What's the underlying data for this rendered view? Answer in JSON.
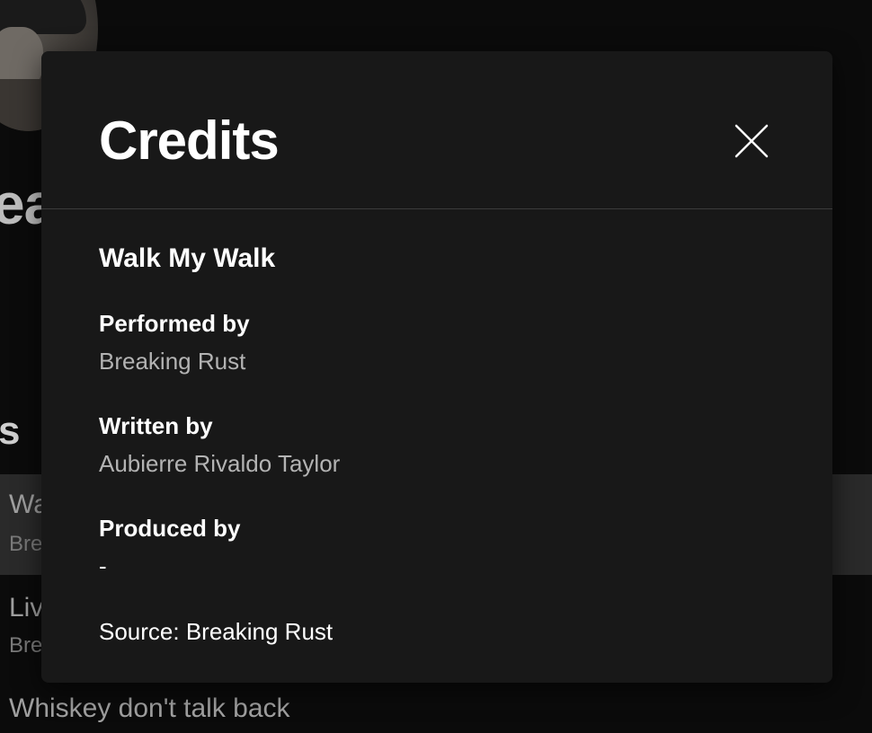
{
  "background": {
    "title_fragment": "ea",
    "section_fragment": "s",
    "tracks": [
      {
        "title_fragment": "Wa",
        "artist_fragment": "Bre"
      },
      {
        "title_fragment": "Liv",
        "artist_fragment": "Bre"
      },
      {
        "title": "Whiskey don't talk back"
      }
    ]
  },
  "modal": {
    "title": "Credits",
    "close_icon": "close-icon",
    "song_title": "Walk My Walk",
    "credits": [
      {
        "label": "Performed by",
        "value": "Breaking Rust"
      },
      {
        "label": "Written by",
        "value": "Aubierre Rivaldo Taylor"
      },
      {
        "label": "Produced by",
        "value": "-"
      }
    ],
    "source": "Source: Breaking Rust"
  }
}
